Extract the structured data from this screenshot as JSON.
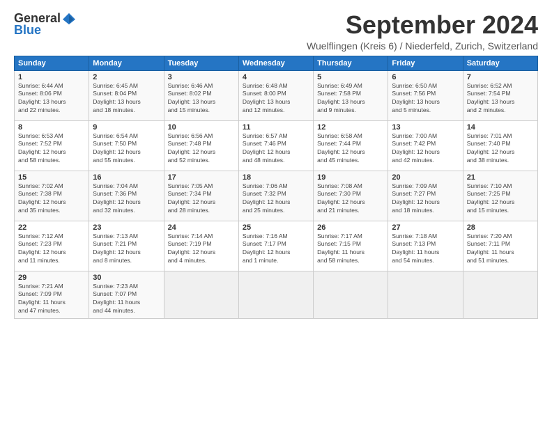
{
  "header": {
    "logo_general": "General",
    "logo_blue": "Blue",
    "month_title": "September 2024",
    "location": "Wuelflingen (Kreis 6) / Niederfeld, Zurich, Switzerland"
  },
  "weekdays": [
    "Sunday",
    "Monday",
    "Tuesday",
    "Wednesday",
    "Thursday",
    "Friday",
    "Saturday"
  ],
  "weeks": [
    [
      {
        "day": "1",
        "info": "Sunrise: 6:44 AM\nSunset: 8:06 PM\nDaylight: 13 hours\nand 22 minutes."
      },
      {
        "day": "2",
        "info": "Sunrise: 6:45 AM\nSunset: 8:04 PM\nDaylight: 13 hours\nand 18 minutes."
      },
      {
        "day": "3",
        "info": "Sunrise: 6:46 AM\nSunset: 8:02 PM\nDaylight: 13 hours\nand 15 minutes."
      },
      {
        "day": "4",
        "info": "Sunrise: 6:48 AM\nSunset: 8:00 PM\nDaylight: 13 hours\nand 12 minutes."
      },
      {
        "day": "5",
        "info": "Sunrise: 6:49 AM\nSunset: 7:58 PM\nDaylight: 13 hours\nand 9 minutes."
      },
      {
        "day": "6",
        "info": "Sunrise: 6:50 AM\nSunset: 7:56 PM\nDaylight: 13 hours\nand 5 minutes."
      },
      {
        "day": "7",
        "info": "Sunrise: 6:52 AM\nSunset: 7:54 PM\nDaylight: 13 hours\nand 2 minutes."
      }
    ],
    [
      {
        "day": "8",
        "info": "Sunrise: 6:53 AM\nSunset: 7:52 PM\nDaylight: 12 hours\nand 58 minutes."
      },
      {
        "day": "9",
        "info": "Sunrise: 6:54 AM\nSunset: 7:50 PM\nDaylight: 12 hours\nand 55 minutes."
      },
      {
        "day": "10",
        "info": "Sunrise: 6:56 AM\nSunset: 7:48 PM\nDaylight: 12 hours\nand 52 minutes."
      },
      {
        "day": "11",
        "info": "Sunrise: 6:57 AM\nSunset: 7:46 PM\nDaylight: 12 hours\nand 48 minutes."
      },
      {
        "day": "12",
        "info": "Sunrise: 6:58 AM\nSunset: 7:44 PM\nDaylight: 12 hours\nand 45 minutes."
      },
      {
        "day": "13",
        "info": "Sunrise: 7:00 AM\nSunset: 7:42 PM\nDaylight: 12 hours\nand 42 minutes."
      },
      {
        "day": "14",
        "info": "Sunrise: 7:01 AM\nSunset: 7:40 PM\nDaylight: 12 hours\nand 38 minutes."
      }
    ],
    [
      {
        "day": "15",
        "info": "Sunrise: 7:02 AM\nSunset: 7:38 PM\nDaylight: 12 hours\nand 35 minutes."
      },
      {
        "day": "16",
        "info": "Sunrise: 7:04 AM\nSunset: 7:36 PM\nDaylight: 12 hours\nand 32 minutes."
      },
      {
        "day": "17",
        "info": "Sunrise: 7:05 AM\nSunset: 7:34 PM\nDaylight: 12 hours\nand 28 minutes."
      },
      {
        "day": "18",
        "info": "Sunrise: 7:06 AM\nSunset: 7:32 PM\nDaylight: 12 hours\nand 25 minutes."
      },
      {
        "day": "19",
        "info": "Sunrise: 7:08 AM\nSunset: 7:30 PM\nDaylight: 12 hours\nand 21 minutes."
      },
      {
        "day": "20",
        "info": "Sunrise: 7:09 AM\nSunset: 7:27 PM\nDaylight: 12 hours\nand 18 minutes."
      },
      {
        "day": "21",
        "info": "Sunrise: 7:10 AM\nSunset: 7:25 PM\nDaylight: 12 hours\nand 15 minutes."
      }
    ],
    [
      {
        "day": "22",
        "info": "Sunrise: 7:12 AM\nSunset: 7:23 PM\nDaylight: 12 hours\nand 11 minutes."
      },
      {
        "day": "23",
        "info": "Sunrise: 7:13 AM\nSunset: 7:21 PM\nDaylight: 12 hours\nand 8 minutes."
      },
      {
        "day": "24",
        "info": "Sunrise: 7:14 AM\nSunset: 7:19 PM\nDaylight: 12 hours\nand 4 minutes."
      },
      {
        "day": "25",
        "info": "Sunrise: 7:16 AM\nSunset: 7:17 PM\nDaylight: 12 hours\nand 1 minute."
      },
      {
        "day": "26",
        "info": "Sunrise: 7:17 AM\nSunset: 7:15 PM\nDaylight: 11 hours\nand 58 minutes."
      },
      {
        "day": "27",
        "info": "Sunrise: 7:18 AM\nSunset: 7:13 PM\nDaylight: 11 hours\nand 54 minutes."
      },
      {
        "day": "28",
        "info": "Sunrise: 7:20 AM\nSunset: 7:11 PM\nDaylight: 11 hours\nand 51 minutes."
      }
    ],
    [
      {
        "day": "29",
        "info": "Sunrise: 7:21 AM\nSunset: 7:09 PM\nDaylight: 11 hours\nand 47 minutes."
      },
      {
        "day": "30",
        "info": "Sunrise: 7:23 AM\nSunset: 7:07 PM\nDaylight: 11 hours\nand 44 minutes."
      },
      null,
      null,
      null,
      null,
      null
    ]
  ]
}
